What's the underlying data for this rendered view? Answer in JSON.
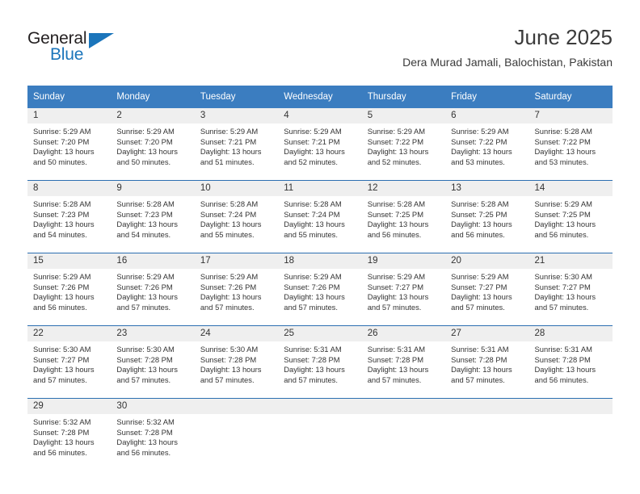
{
  "brand": {
    "name_part1": "General",
    "name_part2": "Blue",
    "triangle_color": "#1b75bb",
    "text_color": "#231f20"
  },
  "header": {
    "title": "June 2025",
    "subtitle": "Dera Murad Jamali, Balochistan, Pakistan"
  },
  "theme": {
    "header_blue": "#3b7dc0",
    "grid_line": "#2c6fb1",
    "daynum_bg": "#efefef",
    "text": "#333333"
  },
  "weekdays": [
    "Sunday",
    "Monday",
    "Tuesday",
    "Wednesday",
    "Thursday",
    "Friday",
    "Saturday"
  ],
  "days": [
    {
      "n": "1",
      "sunrise": "Sunrise: 5:29 AM",
      "sunset": "Sunset: 7:20 PM",
      "daylight1": "Daylight: 13 hours",
      "daylight2": "and 50 minutes."
    },
    {
      "n": "2",
      "sunrise": "Sunrise: 5:29 AM",
      "sunset": "Sunset: 7:20 PM",
      "daylight1": "Daylight: 13 hours",
      "daylight2": "and 50 minutes."
    },
    {
      "n": "3",
      "sunrise": "Sunrise: 5:29 AM",
      "sunset": "Sunset: 7:21 PM",
      "daylight1": "Daylight: 13 hours",
      "daylight2": "and 51 minutes."
    },
    {
      "n": "4",
      "sunrise": "Sunrise: 5:29 AM",
      "sunset": "Sunset: 7:21 PM",
      "daylight1": "Daylight: 13 hours",
      "daylight2": "and 52 minutes."
    },
    {
      "n": "5",
      "sunrise": "Sunrise: 5:29 AM",
      "sunset": "Sunset: 7:22 PM",
      "daylight1": "Daylight: 13 hours",
      "daylight2": "and 52 minutes."
    },
    {
      "n": "6",
      "sunrise": "Sunrise: 5:29 AM",
      "sunset": "Sunset: 7:22 PM",
      "daylight1": "Daylight: 13 hours",
      "daylight2": "and 53 minutes."
    },
    {
      "n": "7",
      "sunrise": "Sunrise: 5:28 AM",
      "sunset": "Sunset: 7:22 PM",
      "daylight1": "Daylight: 13 hours",
      "daylight2": "and 53 minutes."
    },
    {
      "n": "8",
      "sunrise": "Sunrise: 5:28 AM",
      "sunset": "Sunset: 7:23 PM",
      "daylight1": "Daylight: 13 hours",
      "daylight2": "and 54 minutes."
    },
    {
      "n": "9",
      "sunrise": "Sunrise: 5:28 AM",
      "sunset": "Sunset: 7:23 PM",
      "daylight1": "Daylight: 13 hours",
      "daylight2": "and 54 minutes."
    },
    {
      "n": "10",
      "sunrise": "Sunrise: 5:28 AM",
      "sunset": "Sunset: 7:24 PM",
      "daylight1": "Daylight: 13 hours",
      "daylight2": "and 55 minutes."
    },
    {
      "n": "11",
      "sunrise": "Sunrise: 5:28 AM",
      "sunset": "Sunset: 7:24 PM",
      "daylight1": "Daylight: 13 hours",
      "daylight2": "and 55 minutes."
    },
    {
      "n": "12",
      "sunrise": "Sunrise: 5:28 AM",
      "sunset": "Sunset: 7:25 PM",
      "daylight1": "Daylight: 13 hours",
      "daylight2": "and 56 minutes."
    },
    {
      "n": "13",
      "sunrise": "Sunrise: 5:28 AM",
      "sunset": "Sunset: 7:25 PM",
      "daylight1": "Daylight: 13 hours",
      "daylight2": "and 56 minutes."
    },
    {
      "n": "14",
      "sunrise": "Sunrise: 5:29 AM",
      "sunset": "Sunset: 7:25 PM",
      "daylight1": "Daylight: 13 hours",
      "daylight2": "and 56 minutes."
    },
    {
      "n": "15",
      "sunrise": "Sunrise: 5:29 AM",
      "sunset": "Sunset: 7:26 PM",
      "daylight1": "Daylight: 13 hours",
      "daylight2": "and 56 minutes."
    },
    {
      "n": "16",
      "sunrise": "Sunrise: 5:29 AM",
      "sunset": "Sunset: 7:26 PM",
      "daylight1": "Daylight: 13 hours",
      "daylight2": "and 57 minutes."
    },
    {
      "n": "17",
      "sunrise": "Sunrise: 5:29 AM",
      "sunset": "Sunset: 7:26 PM",
      "daylight1": "Daylight: 13 hours",
      "daylight2": "and 57 minutes."
    },
    {
      "n": "18",
      "sunrise": "Sunrise: 5:29 AM",
      "sunset": "Sunset: 7:26 PM",
      "daylight1": "Daylight: 13 hours",
      "daylight2": "and 57 minutes."
    },
    {
      "n": "19",
      "sunrise": "Sunrise: 5:29 AM",
      "sunset": "Sunset: 7:27 PM",
      "daylight1": "Daylight: 13 hours",
      "daylight2": "and 57 minutes."
    },
    {
      "n": "20",
      "sunrise": "Sunrise: 5:29 AM",
      "sunset": "Sunset: 7:27 PM",
      "daylight1": "Daylight: 13 hours",
      "daylight2": "and 57 minutes."
    },
    {
      "n": "21",
      "sunrise": "Sunrise: 5:30 AM",
      "sunset": "Sunset: 7:27 PM",
      "daylight1": "Daylight: 13 hours",
      "daylight2": "and 57 minutes."
    },
    {
      "n": "22",
      "sunrise": "Sunrise: 5:30 AM",
      "sunset": "Sunset: 7:27 PM",
      "daylight1": "Daylight: 13 hours",
      "daylight2": "and 57 minutes."
    },
    {
      "n": "23",
      "sunrise": "Sunrise: 5:30 AM",
      "sunset": "Sunset: 7:28 PM",
      "daylight1": "Daylight: 13 hours",
      "daylight2": "and 57 minutes."
    },
    {
      "n": "24",
      "sunrise": "Sunrise: 5:30 AM",
      "sunset": "Sunset: 7:28 PM",
      "daylight1": "Daylight: 13 hours",
      "daylight2": "and 57 minutes."
    },
    {
      "n": "25",
      "sunrise": "Sunrise: 5:31 AM",
      "sunset": "Sunset: 7:28 PM",
      "daylight1": "Daylight: 13 hours",
      "daylight2": "and 57 minutes."
    },
    {
      "n": "26",
      "sunrise": "Sunrise: 5:31 AM",
      "sunset": "Sunset: 7:28 PM",
      "daylight1": "Daylight: 13 hours",
      "daylight2": "and 57 minutes."
    },
    {
      "n": "27",
      "sunrise": "Sunrise: 5:31 AM",
      "sunset": "Sunset: 7:28 PM",
      "daylight1": "Daylight: 13 hours",
      "daylight2": "and 57 minutes."
    },
    {
      "n": "28",
      "sunrise": "Sunrise: 5:31 AM",
      "sunset": "Sunset: 7:28 PM",
      "daylight1": "Daylight: 13 hours",
      "daylight2": "and 56 minutes."
    },
    {
      "n": "29",
      "sunrise": "Sunrise: 5:32 AM",
      "sunset": "Sunset: 7:28 PM",
      "daylight1": "Daylight: 13 hours",
      "daylight2": "and 56 minutes."
    },
    {
      "n": "30",
      "sunrise": "Sunrise: 5:32 AM",
      "sunset": "Sunset: 7:28 PM",
      "daylight1": "Daylight: 13 hours",
      "daylight2": "and 56 minutes."
    }
  ]
}
